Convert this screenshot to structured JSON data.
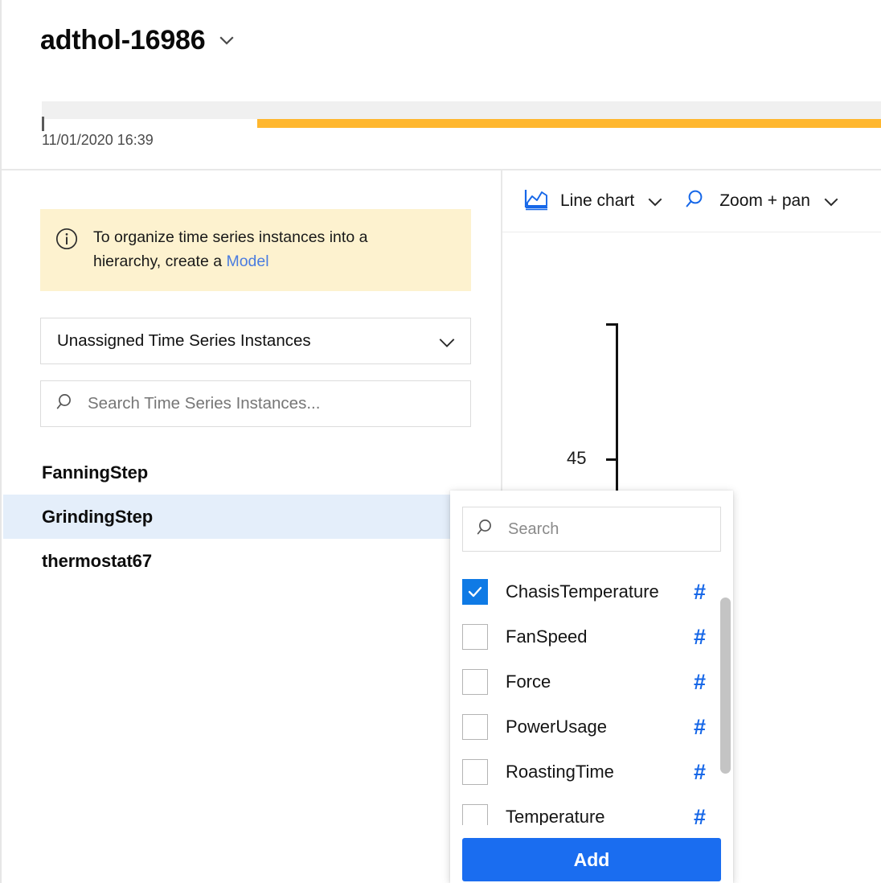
{
  "header": {
    "environment_title": "adthol-16986",
    "environment_chevron_icon": "chevron-down-icon",
    "timeline": {
      "start_label": "11/01/2020 16:39",
      "track_color": "#F0F0F0",
      "availability_color": "#FFB72E"
    }
  },
  "left_panel": {
    "info_banner": {
      "icon": "info-circle-icon",
      "text": "To organize time series instances into a hierarchy, create a ",
      "link_text": "Model",
      "background_color": "#FDF2CF",
      "link_color": "#4A7CE0"
    },
    "hierarchy_select": {
      "value": "Unassigned Time Series Instances",
      "chevron_icon": "chevron-down-icon"
    },
    "instance_search": {
      "icon": "search-icon",
      "placeholder": "Search Time Series Instances...",
      "value": ""
    },
    "instances": [
      {
        "name": "FanningStep",
        "selected": false
      },
      {
        "name": "GrindingStep",
        "selected": true
      },
      {
        "name": "thermostat67",
        "selected": false
      }
    ],
    "selected_row_color": "#E4EEFA"
  },
  "chart_panel": {
    "toolbar": {
      "chart_type": {
        "icon": "line-chart-icon",
        "label": "Line chart",
        "chevron_icon": "chevron-down-icon"
      },
      "interaction_mode": {
        "icon": "magnifier-icon",
        "label": "Zoom + pan",
        "chevron_icon": "chevron-down-icon"
      }
    }
  },
  "chart_data": {
    "type": "line",
    "title": "",
    "xlabel": "",
    "ylabel": "",
    "series": [],
    "y_ticks": [
      "45"
    ],
    "x_ticks": [],
    "grid": false,
    "legend": "none",
    "axis_color": "#111111"
  },
  "variables_popup": {
    "search": {
      "icon": "search-icon",
      "placeholder": "Search",
      "value": ""
    },
    "variables": [
      {
        "name": "ChasisTemperature",
        "checked": true,
        "type_icon": "#"
      },
      {
        "name": "FanSpeed",
        "checked": false,
        "type_icon": "#"
      },
      {
        "name": "Force",
        "checked": false,
        "type_icon": "#"
      },
      {
        "name": "PowerUsage",
        "checked": false,
        "type_icon": "#"
      },
      {
        "name": "RoastingTime",
        "checked": false,
        "type_icon": "#"
      },
      {
        "name": "Temperature",
        "checked": false,
        "type_icon": "#"
      }
    ],
    "add_button_label": "Add",
    "accent_color": "#0F7AE5",
    "add_button_color": "#1A6DF0",
    "type_icon_color": "#1667E8",
    "scrollbar_color": "#C4C4C4"
  }
}
